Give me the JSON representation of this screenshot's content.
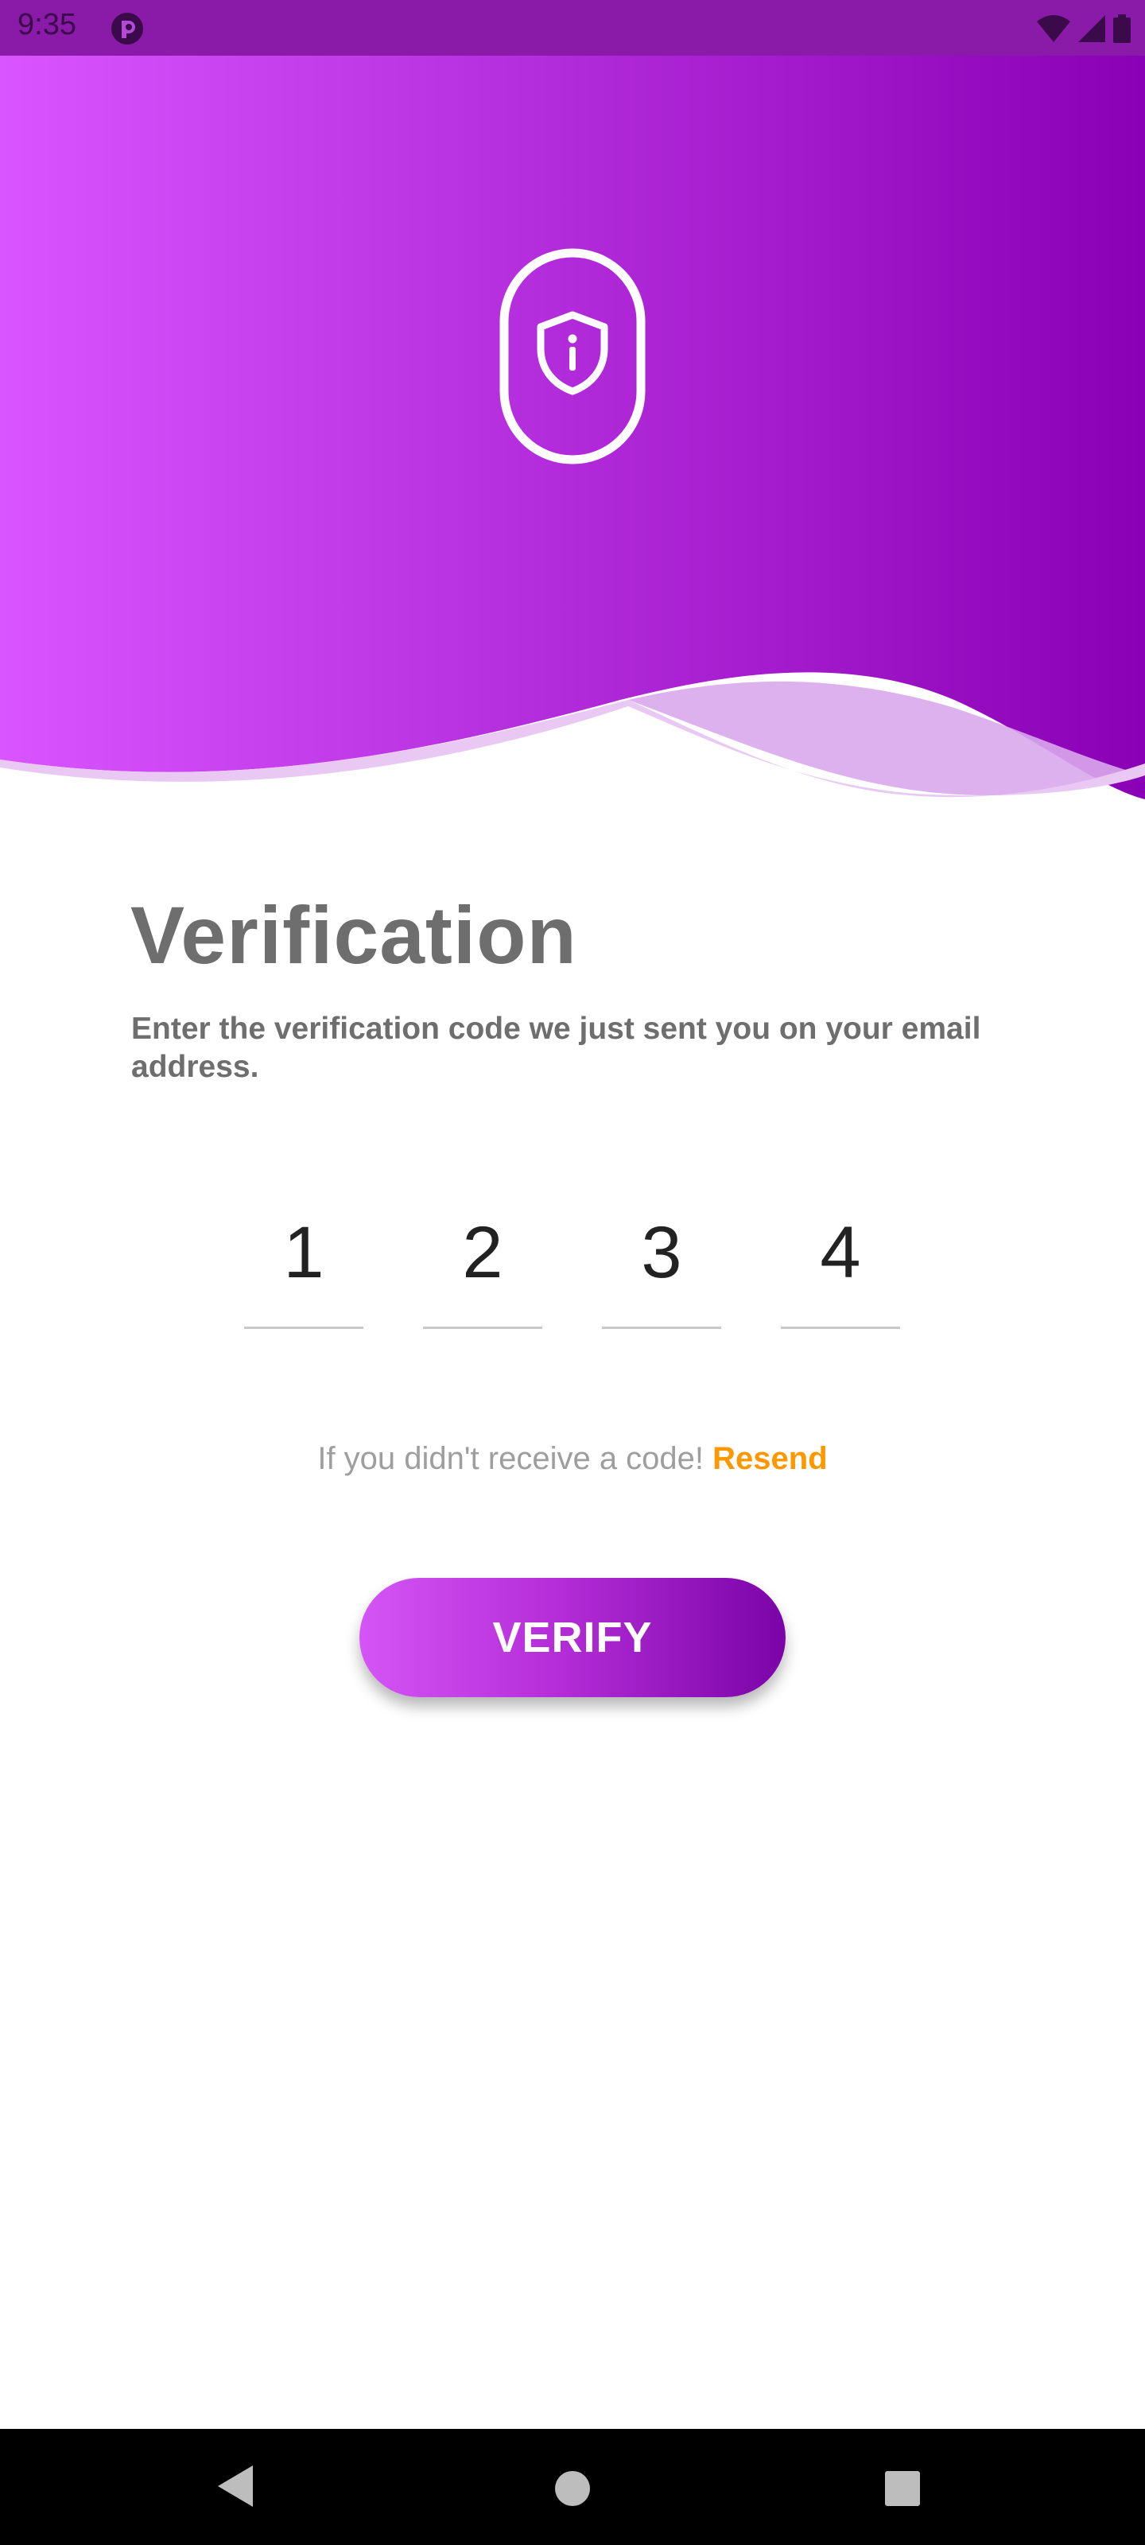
{
  "status_bar": {
    "time": "9:35",
    "app_icon": "app-notification-icon",
    "icons": [
      "wifi-icon",
      "signal-icon",
      "battery-icon"
    ]
  },
  "header": {
    "icon": "phone-shield-icon",
    "gradient_colors": [
      "#d955ff",
      "#8a00b5"
    ]
  },
  "verification": {
    "title": "Verification",
    "subtitle": "Enter the verification code we just sent you on your email address.",
    "code_digits": [
      "1",
      "2",
      "3",
      "4"
    ],
    "resend_prompt": "If you didn't receive a code!",
    "resend_link": "Resend",
    "verify_button": "VERIFY"
  },
  "colors": {
    "accent_orange": "#ff9800",
    "title_gray": "#6e6e6e",
    "button_start": "#d455f5",
    "button_end": "#7a04a8"
  },
  "nav_bar": {
    "buttons": [
      "back-icon",
      "home-icon",
      "recents-icon"
    ]
  }
}
